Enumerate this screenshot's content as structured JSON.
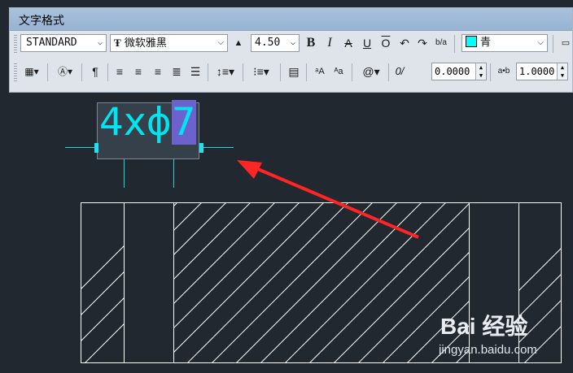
{
  "window": {
    "title": "文字格式"
  },
  "toolbar": {
    "style_value": "STANDARD",
    "font_value": "微软雅黑",
    "font_icon": "truetype-icon",
    "height_value": "4.50",
    "bold_label": "B",
    "italic_label": "I",
    "strike_label": "A",
    "underline_label": "U",
    "overline_label": "O",
    "undo_icon": "undo-icon",
    "redo_icon": "redo-icon",
    "stack_label": "b/a",
    "color_value": "青",
    "color_hex": "#00ffff",
    "oblique_value": "0.0000",
    "tracking_value": "1.0000",
    "oblique_label": "0/",
    "tracking_label": "a•b",
    "symbol_label": "@"
  },
  "canvas": {
    "mtext_prefix": "4xϕ",
    "mtext_selected": "7",
    "text_color": "#00e5ef",
    "selection_color": "#6d62cd",
    "arrow_color": "#ff2020"
  },
  "watermark": {
    "brand": "Bai 经验",
    "url": "jingyan.baidu.com"
  }
}
